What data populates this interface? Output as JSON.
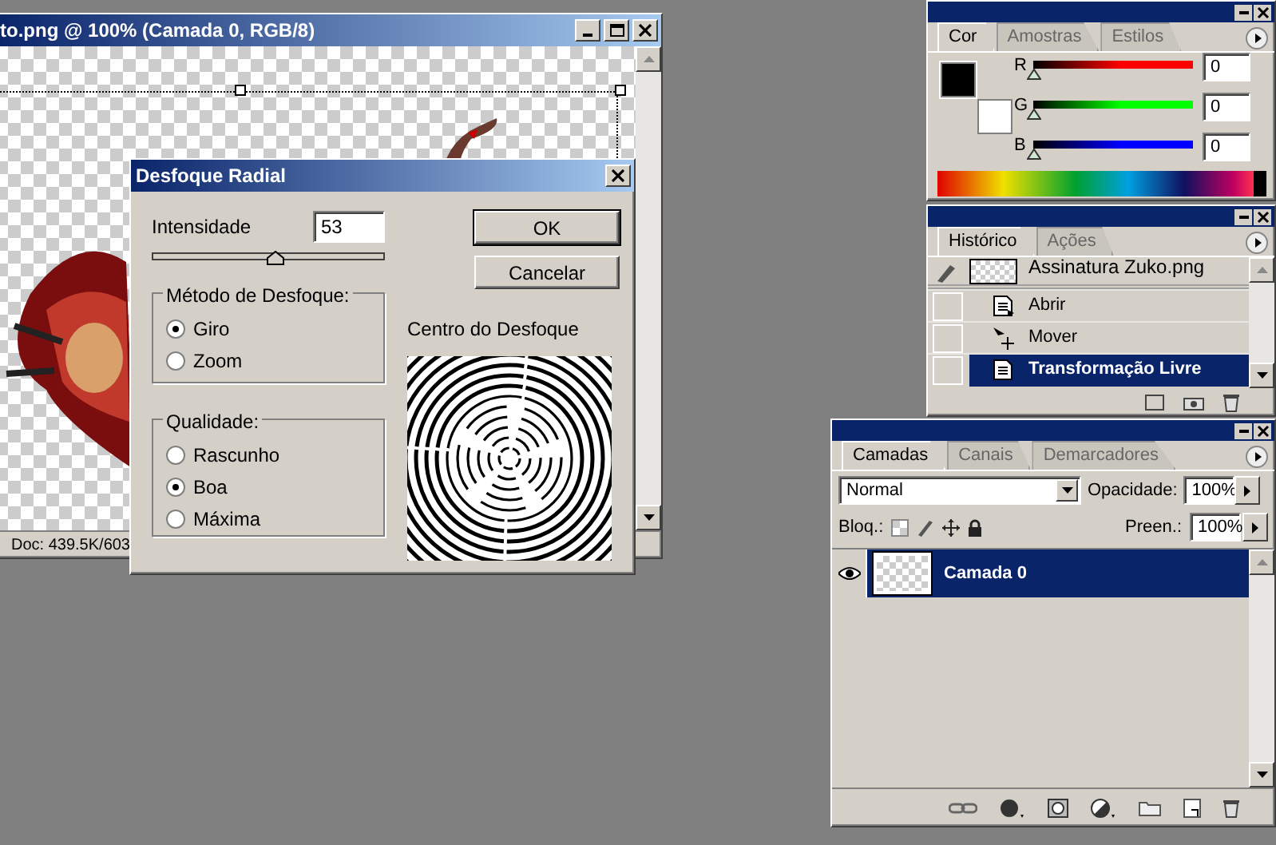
{
  "document_window": {
    "title": "to.png @ 100% (Camada 0, RGB/8)",
    "status": "Doc: 439.5K/603"
  },
  "dialog": {
    "title": "Desfoque Radial",
    "amount": {
      "label": "Intensidade",
      "value": "53",
      "level": 0.53
    },
    "buttons": [
      "OK",
      "Cancelar"
    ],
    "method": {
      "title": "Método de Desfoque:",
      "options": [
        {
          "label": "Giro",
          "selected": true
        },
        {
          "label": "Zoom",
          "selected": false
        }
      ]
    },
    "quality": {
      "title": "Qualidade:",
      "options": [
        {
          "label": "Rascunho",
          "selected": false
        },
        {
          "label": "Boa",
          "selected": true
        },
        {
          "label": "Máxima",
          "selected": false
        }
      ]
    },
    "preview": {
      "label": "Centro do Desfoque"
    }
  },
  "color_panel": {
    "tabs": [
      {
        "label": "Cor",
        "selected": true
      },
      {
        "label": "Amostras",
        "selected": false
      },
      {
        "label": "Estilos",
        "selected": false
      }
    ],
    "channels": [
      {
        "name": "R",
        "value": "0",
        "level": 0,
        "color": "#ff0000"
      },
      {
        "name": "G",
        "value": "0",
        "level": 0,
        "color": "#00ff00"
      },
      {
        "name": "B",
        "value": "0",
        "level": 0,
        "color": "#0000ff"
      }
    ]
  },
  "history_panel": {
    "tabs": [
      {
        "label": "Histórico",
        "selected": true
      },
      {
        "label": "Ações",
        "selected": false
      }
    ],
    "snapshot": {
      "name": "Assinatura Zuko.png"
    },
    "items": [
      {
        "name": "Abrir",
        "kind": "open",
        "selected": false
      },
      {
        "name": "Mover",
        "kind": "move",
        "selected": false
      },
      {
        "name": "Transformação Livre",
        "kind": "transform",
        "selected": true
      }
    ]
  },
  "layers_panel": {
    "tabs": [
      {
        "label": "Camadas",
        "selected": true
      },
      {
        "label": "Canais",
        "selected": false
      },
      {
        "label": "Demarcadores",
        "selected": false
      }
    ],
    "blend_mode": "Normal",
    "opacity_label": "Opacidade:",
    "opacity": "100%",
    "lock_label": "Bloq.:",
    "fill_label": "Preen.:",
    "fill": "100%",
    "layers": [
      {
        "name": "Camada 0",
        "visible": true,
        "selected": true
      }
    ]
  }
}
